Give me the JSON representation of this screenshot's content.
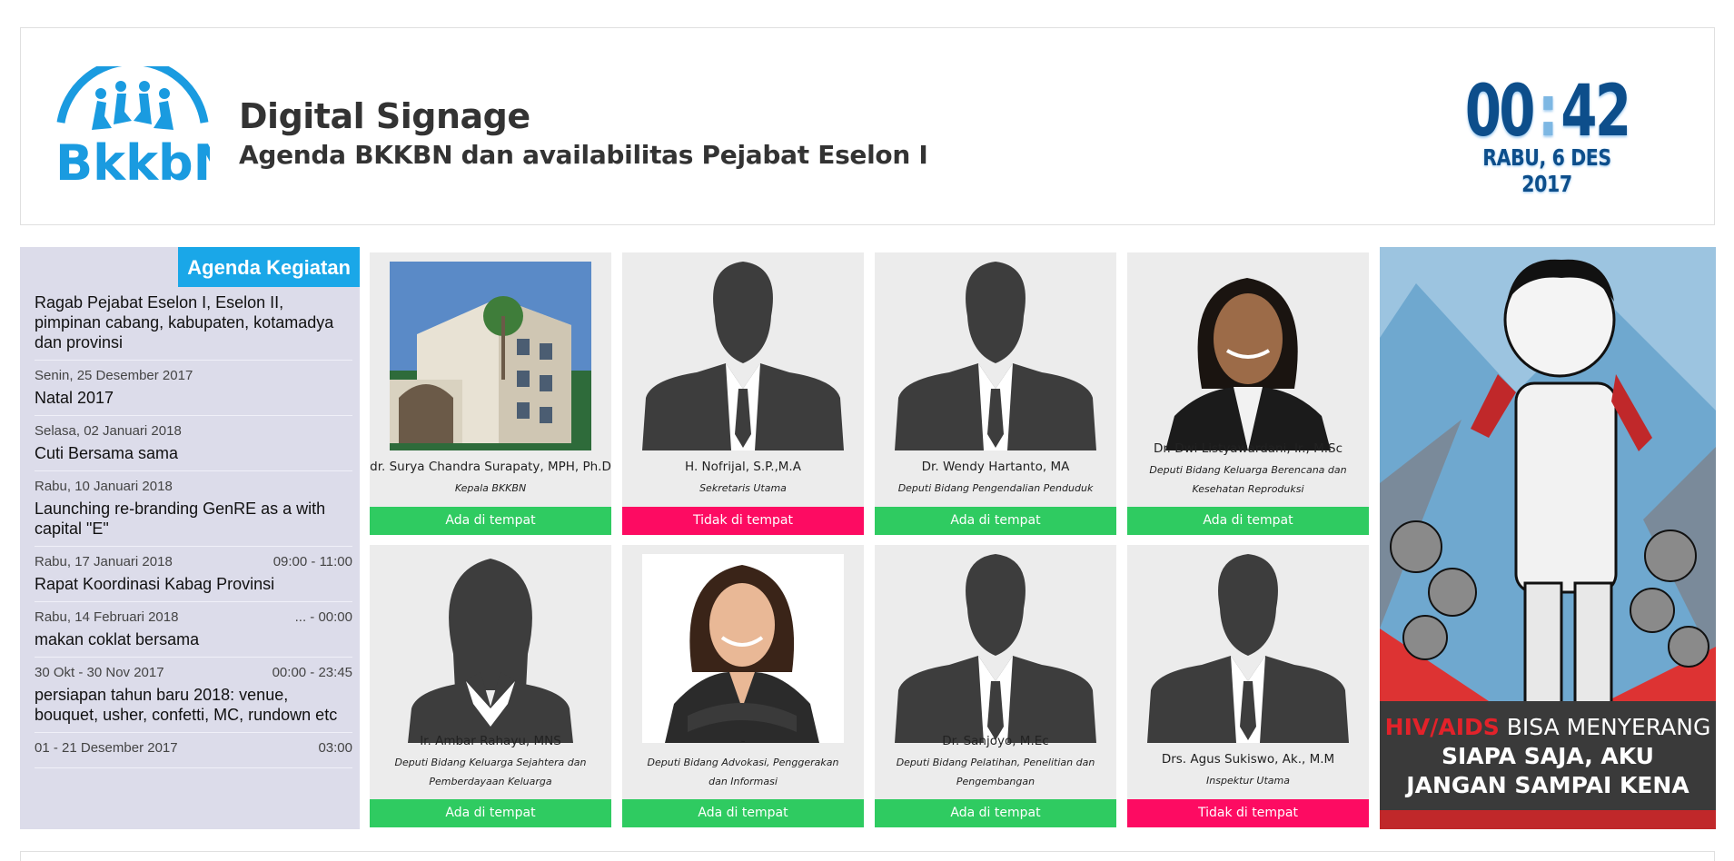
{
  "header": {
    "logo_text": "BkkbN",
    "title": "Digital Signage",
    "subtitle": "Agenda BKKBN dan availabilitas Pejabat Eselon I",
    "clock_hours": "00",
    "clock_sep": ":",
    "clock_minutes": "42",
    "date": "RABU, 6 DES 2017"
  },
  "agenda": {
    "header": "Agenda Kegiatan",
    "items": [
      {
        "date": "",
        "time": "",
        "title": "Ragab Pejabat Eselon I, Eselon II, pimpinan cabang, kabupaten, kotamadya dan provinsi"
      },
      {
        "date": "Senin, 25 Desember 2017",
        "time": "",
        "title": "Natal 2017"
      },
      {
        "date": "Selasa, 02 Januari 2018",
        "time": "",
        "title": "Cuti  Bersama sama"
      },
      {
        "date": "Rabu, 10 Januari 2018",
        "time": "",
        "title": "Launching re-branding GenRE as a with capital \"E\""
      },
      {
        "date": "Rabu, 17 Januari 2018",
        "time": "09:00 - 11:00",
        "title": "Rapat Koordinasi Kabag Provinsi"
      },
      {
        "date": "Rabu, 14 Februari 2018",
        "time": "... - 00:00",
        "title": "makan coklat bersama"
      },
      {
        "date": "30 Okt - 30 Nov 2017",
        "time": "00:00 - 23:45",
        "title": "persiapan tahun baru 2018: venue, bouquet, usher, confetti, MC, rundown etc"
      },
      {
        "date": "01 - 21 Desember 2017",
        "time": "03:00",
        "title": ""
      }
    ]
  },
  "officials": [
    {
      "name": "dr. Surya Chandra Surapaty, MPH, Ph.D",
      "role": "Kepala BKKBN",
      "status": "Ada di tempat",
      "photo": "building-photo"
    },
    {
      "name": "H. Nofrijal, S.P.,M.A",
      "role": "Sekretaris Utama",
      "status": "Tidak di tempat",
      "photo": "male-silhouette"
    },
    {
      "name": "Dr. Wendy Hartanto, MA",
      "role": "Deputi Bidang Pengendalian Penduduk",
      "status": "Ada di tempat",
      "photo": "male-silhouette"
    },
    {
      "name": "Dr. Dwi Listyawardani, Ir., M.Sc",
      "role": "Deputi Bidang Keluarga Berencana dan Kesehatan Reproduksi",
      "status": "Ada di tempat",
      "photo": "female-portrait"
    },
    {
      "name": "Ir. Ambar Rahayu, MNS",
      "role": "Deputi Bidang Keluarga Sejahtera dan Pemberdayaan Keluarga",
      "status": "Ada di tempat",
      "photo": "female-silhouette"
    },
    {
      "name": "-",
      "role": "Deputi Bidang Advokasi, Penggerakan dan Informasi",
      "status": "Ada di tempat",
      "photo": "female-portrait-2"
    },
    {
      "name": "Dr. Sanjoyo, M.Ec",
      "role": "Deputi Bidang Pelatihan, Penelitian dan Pengembangan",
      "status": "Ada di tempat",
      "photo": "male-silhouette"
    },
    {
      "name": "Drs. Agus Sukiswo, Ak., M.M",
      "role": "Inspektur Utama",
      "status": "Tidak di tempat",
      "photo": "male-silhouette"
    }
  ],
  "poster": {
    "line1_red": "HIV/AIDS",
    "line1_rest": " BISA MENYERANG",
    "line2": "SIAPA SAJA, AKU",
    "line3": "JANGAN SAMPAI KENA"
  },
  "colors": {
    "status_present": "#2fcb61",
    "status_absent": "#fd0b62",
    "agenda_header": "#1aa7e8",
    "clock": "#0d4e8b"
  }
}
